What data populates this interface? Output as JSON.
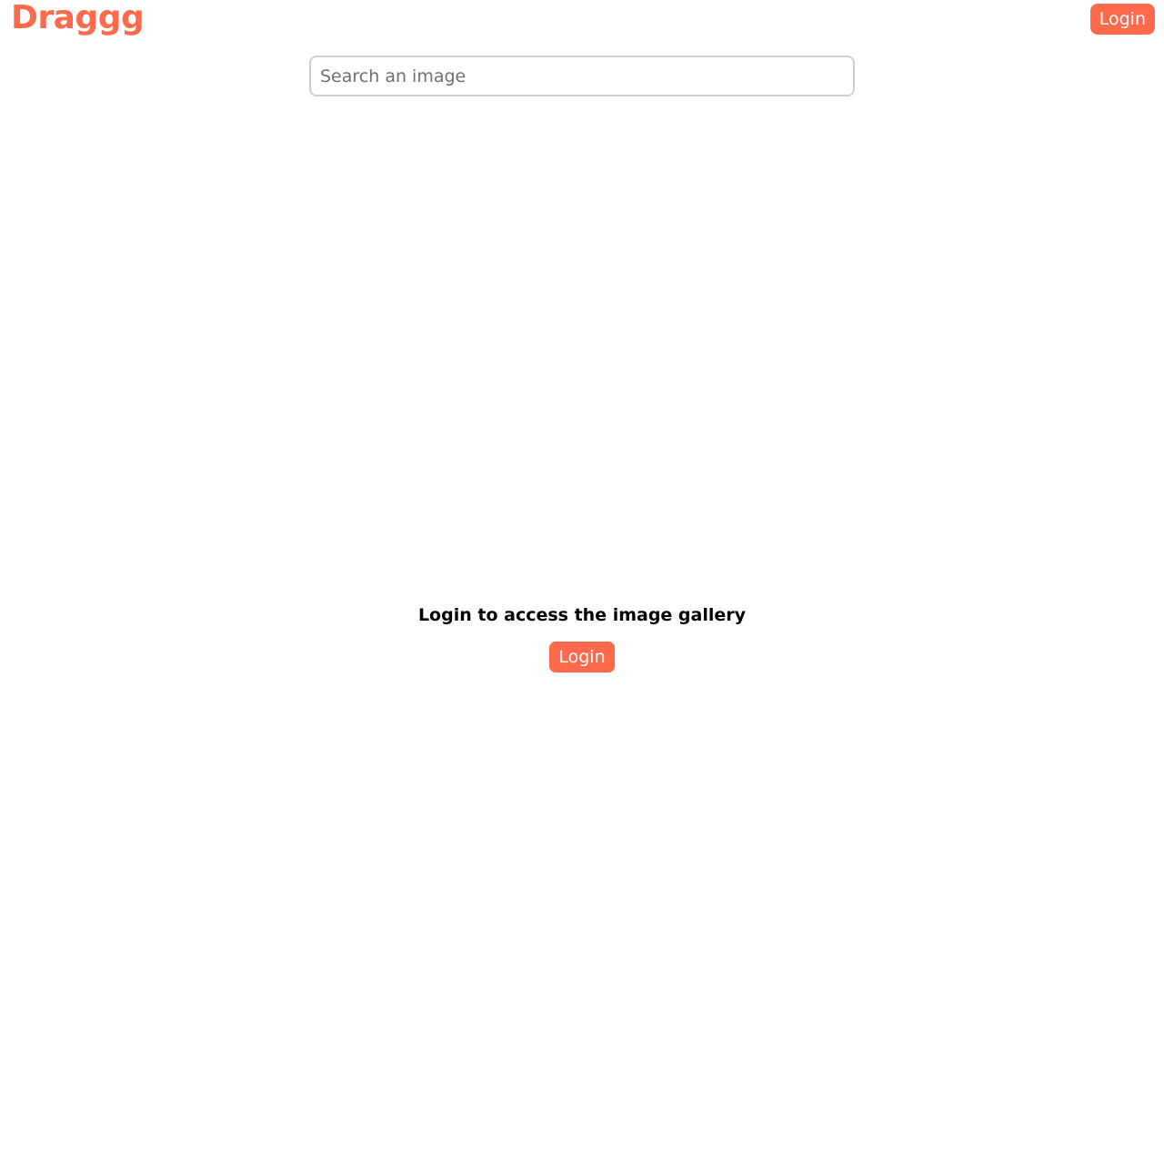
{
  "colors": {
    "accent": "#ff6a4d",
    "background": "#ffffff"
  },
  "header": {
    "logo": "Draggg",
    "login_label": "Login"
  },
  "search": {
    "placeholder": "Search an image",
    "value": ""
  },
  "main": {
    "prompt_text": "Login to access the image gallery",
    "login_label": "Login"
  }
}
